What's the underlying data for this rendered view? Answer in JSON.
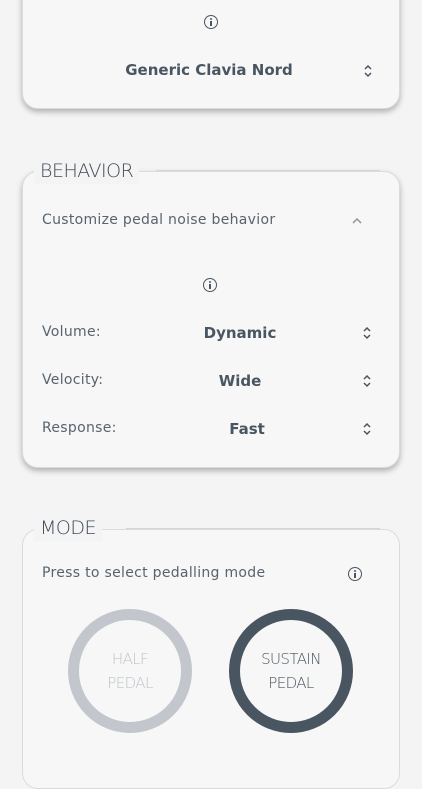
{
  "device": {
    "info_icon": "info-icon",
    "selected_value": "Generic Clavia Nord",
    "stepper_icon": "up-down-stepper-icon"
  },
  "behavior": {
    "title": "BEHAVIOR",
    "subtitle": "Customize pedal noise behavior",
    "collapse_icon": "chevron-up-icon",
    "info_icon": "info-icon",
    "rows": [
      {
        "label": "Volume:",
        "value": "Dynamic"
      },
      {
        "label": "Velocity:",
        "value": "Wide"
      },
      {
        "label": "Response:",
        "value": "Fast"
      }
    ]
  },
  "mode": {
    "title": "MODE",
    "subtitle": "Press to select pedalling mode",
    "info_icon": "info-icon",
    "buttons": [
      {
        "line1": "HALF",
        "line2": "PEDAL",
        "selected": false
      },
      {
        "line1": "SUSTAIN",
        "line2": "PEDAL",
        "selected": true
      }
    ]
  },
  "colors": {
    "background": "#f3f4f3",
    "text": "#4a5460",
    "pedal_selected": "#4a5562",
    "pedal_unselected": "#c3c6cc"
  }
}
